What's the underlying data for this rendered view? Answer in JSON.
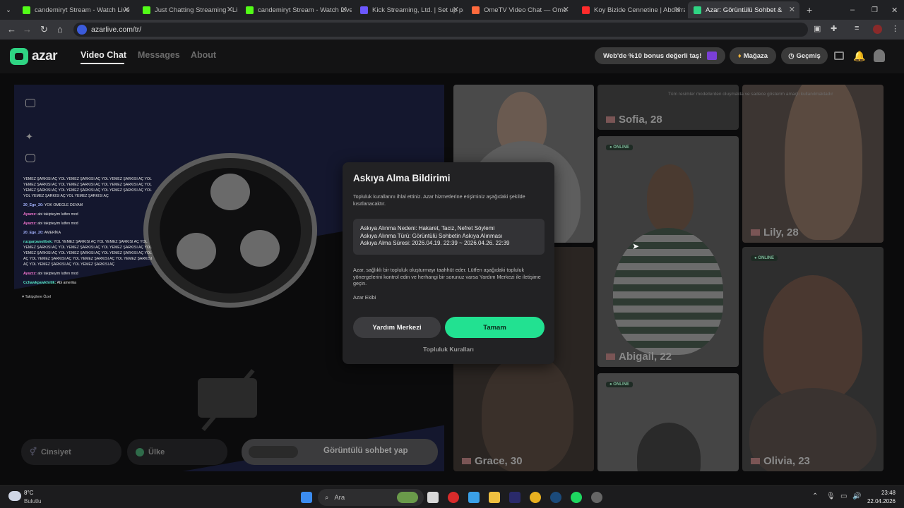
{
  "browser": {
    "tabs": [
      {
        "label": "candemiryt Stream - Watch Live",
        "favicon_color": "#53fc18"
      },
      {
        "label": "Just Chatting Streaming - Live S",
        "favicon_color": "#53fc18"
      },
      {
        "label": "candemiryt Stream - Watch Live",
        "favicon_color": "#53fc18"
      },
      {
        "label": "Kick Streaming, Ltd. | Set up pa",
        "favicon_color": "#6b57ff"
      },
      {
        "label": "OmeTV Video Chat — Ome",
        "favicon_color": "#ff6a3d"
      },
      {
        "label": "Koy Bizide Cennetine | Abdurra",
        "favicon_color": "#ff2b2b"
      },
      {
        "label": "Azar: Görüntülü Sohbet &",
        "favicon_color": "#2fd483"
      }
    ],
    "url": "azarlive.com/tr/"
  },
  "header": {
    "logo": "azar",
    "nav": [
      "Video Chat",
      "Messages",
      "About"
    ],
    "bonus_label": "Web'de %10 bonus değerli taş!",
    "shop_label": "Mağaza",
    "history_label": "Geçmiş"
  },
  "stage": {
    "chat": [
      {
        "user": "",
        "text": "YEMEZ ŞARKISI AÇ YOL YEMEZ ŞARKISI AÇ YOL YEMEZ ŞARKISI AÇ YOL",
        "color": "#e5e5e5"
      },
      {
        "user": "",
        "text": "YEMEZ ŞARKISI AÇ YOL YEMEZ ŞARKISI AÇ YOL YEMEZ ŞARKISI AÇ YOL",
        "color": "#e5e5e5"
      },
      {
        "user": "",
        "text": "YEMEZ ŞARKISI AÇ YOL YEMEZ ŞARKISI AÇ YOL YEMEZ ŞARKISI AÇ YOL",
        "color": "#e5e5e5"
      },
      {
        "user": "",
        "text": "YOL YEMEZ ŞARKISI AÇ YOL YEMEZ ŞARKISI AÇ",
        "color": "#e5e5e5"
      },
      {
        "user": "20_Ege_20:",
        "text": "YOK OMEGLE DEVAM",
        "color": "#a5b4ff"
      },
      {
        "user": "Ayszzz:",
        "text": "abi takipteyim lutfen mod",
        "color": "#ff7ad9"
      },
      {
        "user": "Ayszzz:",
        "text": "abi takipteyim lutfen mod",
        "color": "#ff7ad9"
      },
      {
        "user": "20_Ege_20:",
        "text": "AMERİKA",
        "color": "#a5b4ff"
      },
      {
        "user": "ruzgarpanolibek:",
        "text": "YOL YEMEZ ŞARKISI AÇ YOL YEMEZ ŞARKISI AÇ YOL",
        "color": "#55e0c0"
      },
      {
        "user": "",
        "text": "YEMEZ ŞARKISI AÇ YOL YEMEZ ŞARKISI AÇ YOL YEMEZ ŞARKISI AÇ YOL",
        "color": "#e5e5e5"
      },
      {
        "user": "",
        "text": "YEMEZ ŞARKISI AÇ YOL YEMEZ ŞARKISI AÇ YOL YEMEZ ŞARKISI AÇ YOL",
        "color": "#e5e5e5"
      },
      {
        "user": "",
        "text": "AÇ YOL YEMEZ ŞARKISI AÇ YOL YEMEZ ŞARKISI AÇ YOL YEMEZ ŞARKISI",
        "color": "#e5e5e5"
      },
      {
        "user": "",
        "text": "AÇ YOL YEMEZ ŞARKISI AÇ YOL YEMEZ ŞARKISI AÇ",
        "color": "#e5e5e5"
      },
      {
        "user": "Ayszzz:",
        "text": "abi takipteyim lutfen mod",
        "color": "#ff7ad9"
      },
      {
        "user": "Cchawkpawkfsitik:",
        "text": "Abi amerika",
        "color": "#55e0c0"
      }
    ],
    "followers_only": "Takipçilere Özel",
    "gender_label": "Cinsiyet",
    "country_label": "Ülke",
    "start_label": "Görüntülü sohbet yap"
  },
  "grid": {
    "disclaimer": "Tüm resimler modellerden oluşmakta ve sadece gösterim amaçlı kullanılmaktadır",
    "online_label": "ONLINE",
    "cards": [
      {
        "name": "Sofia, 28"
      },
      {
        "name": "Lily, 28"
      },
      {
        "name": "Abigail, 22"
      },
      {
        "name": "Grace, 30"
      },
      {
        "name": "Olivia, 23"
      }
    ]
  },
  "modal": {
    "title": "Askıya Alma Bildirimi",
    "intro": "Topluluk kurallarını ihlal ettiniz. Azar hizmetlerine erişiminiz aşağıdaki şekilde kısıtlanacaktır.",
    "reason": "Askıya Alınma Nedeni: Hakaret, Taciz, Nefret Söylemi",
    "type": "Askıya Alınma Türü: Görüntülü Sohbetin Askıya Alınması",
    "duration": "Askıya Alma Süresi: 2026.04.19. 22:39 ~ 2026.04.26. 22:39",
    "body": "Azar, sağlıklı bir topluluk oluşturmayı taahhüt eder. Lütfen aşağıdaki topluluk yönergelerini kontrol edin ve herhangi bir sorunuz varsa Yardım Merkezi ile iletişime geçin.",
    "signature": "Azar Ekibi",
    "help_button": "Yardım Merkezi",
    "ok_button": "Tamam",
    "rules_link": "Topluluk Kuralları"
  },
  "taskbar": {
    "temperature": "8°C",
    "weather": "Bulutlu",
    "search_label": "Ara",
    "time": "23:48",
    "date": "22.04.2026"
  }
}
